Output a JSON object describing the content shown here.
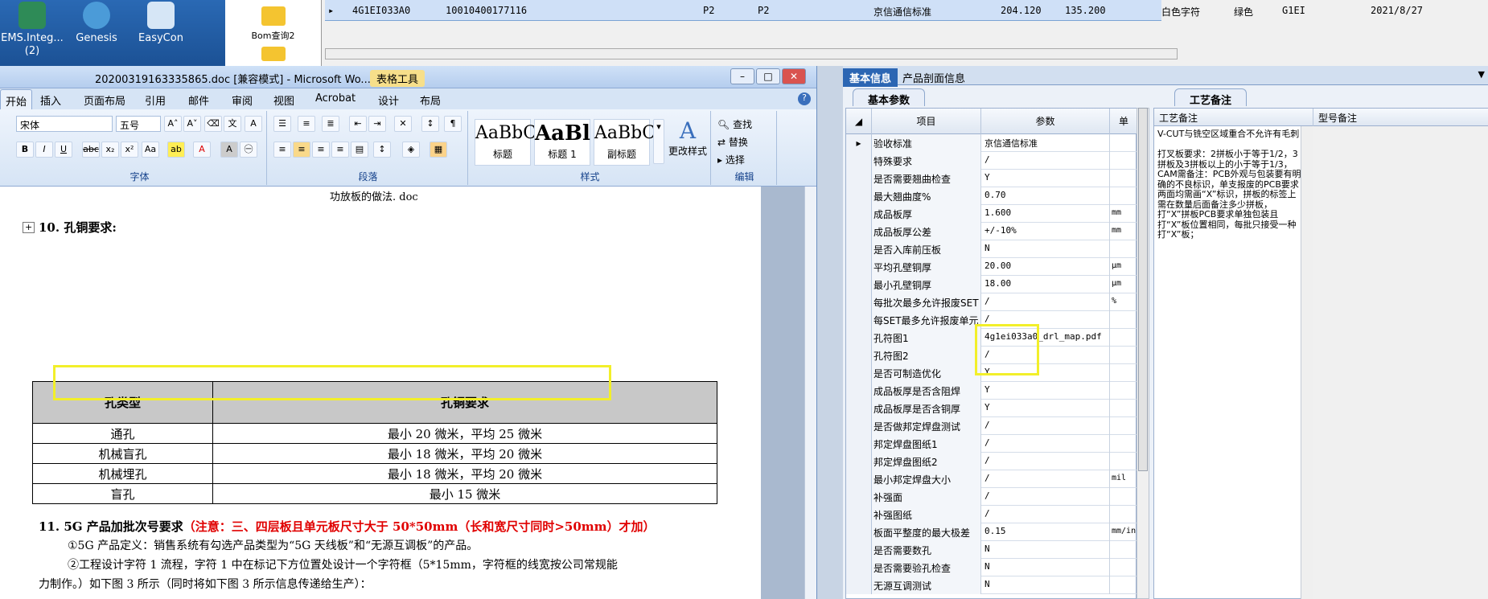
{
  "desktop": {
    "icons": [
      {
        "label": "EMS.Integ...\n(2)"
      },
      {
        "label": "Genesis"
      },
      {
        "label": "EasyCon"
      }
    ]
  },
  "top_app": {
    "folder_label": "Bom查询2",
    "row": [
      "4G1EI033A0",
      "10010400177116",
      "P2",
      "P2",
      "京信通信标准",
      "204.120",
      "135.200",
      "白色字符",
      "绿色",
      "G1EI",
      "2021/8/27"
    ]
  },
  "word": {
    "title": "20200319163335865.doc [兼容模式] - Microsoft Wo...",
    "table_tools": "表格工具",
    "tabs": [
      "开始",
      "插入",
      "页面布局",
      "引用",
      "邮件",
      "审阅",
      "视图",
      "Acrobat",
      "设计",
      "布局"
    ],
    "font_name": "宋体",
    "font_size": "五号",
    "groups": {
      "font": "字体",
      "paragraph": "段落",
      "styles": "样式",
      "edit": "编辑"
    },
    "styles": [
      {
        "sample": "AaBbC",
        "name": "标题"
      },
      {
        "sample": "AaBl",
        "name": "标题 1"
      },
      {
        "sample": "AaBbC",
        "name": "副标题"
      }
    ],
    "change_styles": "更改样式",
    "edit_buttons": [
      "查找",
      "替换",
      "选择"
    ],
    "doc": {
      "caption": "功放板的做法. doc",
      "heading10": "10.  孔铜要求:",
      "table_headers": [
        "孔类型",
        "孔铜要求"
      ],
      "table_rows": [
        [
          "通孔",
          "最小 20 微米，平均 25 微米"
        ],
        [
          "机械盲孔",
          "最小 18 微米，平均 20 微米"
        ],
        [
          "机械埋孔",
          "最小 18 微米，平均 20 微米"
        ],
        [
          "盲孔",
          "最小 15 微米"
        ]
      ],
      "heading11": "11.  5G 产品加批次号要求",
      "heading11_note": "（注意：三、四层板且单元板尺寸大于 50*50mm（长和宽尺寸同时>50mm）才加）",
      "p1": "①5G 产品定义：销售系统有勾选产品类型为“5G 天线板”和“无源互调板”的产品。",
      "p2a": "②工程设计字符 1 流程，字符 1 中在标记下方位置处设计一个字符框（5*15mm，字符框的线宽按公司常规能",
      "p2b": "力制作。）如下图 3 所示（同时将如下图 3 所示信息传递给生产）："
    }
  },
  "panel": {
    "tabs": [
      "基本信息",
      "产品剖面信息"
    ],
    "subtab_left": "基本参数",
    "subtab_right": "工艺备注",
    "grid_headers": [
      "项目",
      "参数",
      "单"
    ],
    "rows": [
      {
        "name": "验收标准",
        "value": "京信通信标准",
        "unit": ""
      },
      {
        "name": "特殊要求",
        "value": "/",
        "unit": ""
      },
      {
        "name": "是否需要翘曲检查",
        "value": "Y",
        "unit": ""
      },
      {
        "name": "最大翘曲度%",
        "value": "0.70",
        "unit": ""
      },
      {
        "name": "成品板厚",
        "value": "1.600",
        "unit": "mm"
      },
      {
        "name": "成品板厚公差",
        "value": "+/-10%",
        "unit": "mm"
      },
      {
        "name": "是否入库前压板",
        "value": "N",
        "unit": ""
      },
      {
        "name": "平均孔壁铜厚",
        "value": "20.00",
        "unit": "μm"
      },
      {
        "name": "最小孔壁铜厚",
        "value": "18.00",
        "unit": "μm"
      },
      {
        "name": "每批次最多允许报废SET",
        "value": "/",
        "unit": "%"
      },
      {
        "name": "每SET最多允许报废单元",
        "value": "/",
        "unit": ""
      },
      {
        "name": "孔符图1",
        "value": "4g1ei033a0_drl_map.pdf",
        "unit": ""
      },
      {
        "name": "孔符图2",
        "value": "/",
        "unit": ""
      },
      {
        "name": "是否可制造优化",
        "value": "Y",
        "unit": ""
      },
      {
        "name": "成品板厚是否含阻焊",
        "value": "Y",
        "unit": ""
      },
      {
        "name": "成品板厚是否含铜厚",
        "value": "Y",
        "unit": ""
      },
      {
        "name": "是否做邦定焊盘测试",
        "value": "/",
        "unit": ""
      },
      {
        "name": "邦定焊盘图纸1",
        "value": "/",
        "unit": ""
      },
      {
        "name": "邦定焊盘图纸2",
        "value": "/",
        "unit": ""
      },
      {
        "name": "最小邦定焊盘大小",
        "value": "/",
        "unit": "mil"
      },
      {
        "name": "补强面",
        "value": "/",
        "unit": ""
      },
      {
        "name": "补强图纸",
        "value": "/",
        "unit": ""
      },
      {
        "name": "板面平整度的最大极差",
        "value": "0.15",
        "unit": "mm/in"
      },
      {
        "name": "是否需要数孔",
        "value": "N",
        "unit": ""
      },
      {
        "name": "是否需要验孔检查",
        "value": "N",
        "unit": ""
      },
      {
        "name": "无源互调测试",
        "value": "N",
        "unit": ""
      }
    ],
    "right_headers": [
      "工艺备注",
      "型号备注"
    ],
    "process_note": "V-CUT与铣空区域重合不允许有毛刺\n\n打叉板要求：2拼板小于等于1/2，3拼板及3拼板以上的小于等于1/3，CAM需备注：PCB外观与包装要有明确的不良标识，单支报废的PCB要求两面均需画“X”标识，拼板的标签上需在数量后面备注多少拼板，打“X”拼板PCB要求单独包装且打“X”板位置相同，每批只接受一种打“X”板；"
  }
}
